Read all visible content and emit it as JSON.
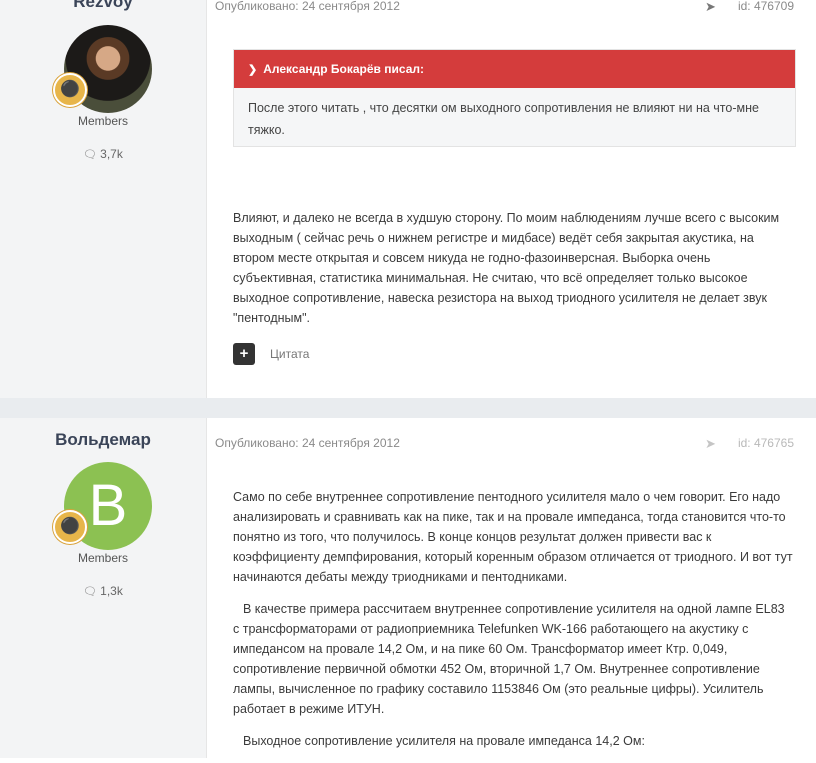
{
  "posts": [
    {
      "author": "Rezvoy",
      "group": "Members",
      "post_count": "3,7k",
      "published": "Опубликовано: 24 сентября 2012",
      "post_id": "id: 476709",
      "quote": {
        "author": "Александр Бокарёв писал:",
        "text": "После этого читать , что десятки ом выходного сопротивления не влияют ни на что-мне тяжко."
      },
      "paragraphs": [
        "Влияют, и далеко не всегда в худшую сторону. По моим наблюдениям лучше всего с высоким выходным ( сейчас речь о нижнем регистре и мидбасе) ведёт себя закрытая акустика, на втором месте открытая и совсем никуда не годно-фазоинверсная. Выборка очень субъективная, статистика минимальная. Не считаю, что всё определяет только высокое выходное сопротивление, навеска резистора на выход триодного усилителя не делает звук \"пентодным\"."
      ],
      "quote_label": "Цитата"
    },
    {
      "author": "Вольдемар",
      "avatar_letter": "B",
      "group": "Members",
      "post_count": "1,3k",
      "published": "Опубликовано: 24 сентября 2012",
      "post_id": "id: 476765",
      "paragraphs": [
        "Само по себе внутреннее сопротивление пентодного усилителя мало о чем говорит. Его надо анализировать и сравнивать как на пике, так и на провале импеданса, тогда становится что-то понятно из того, что получилось. В конце концов результат должен привести вас к коэффициенту демпфирования, который коренным образом отличается от триодного. И вот тут начинаются дебаты между триодниками и пентодниками.",
        "В качестве примера рассчитаем внутреннее сопротивление усилителя на одной лампе EL83 с трансформаторами от радиоприемника Telefunken WK-166 работающего на акустику с импедансом на провале 14,2 Ом, и на пике 60 Ом. Трансформатор имеет Ктр. 0,049, сопротивление первичной обмотки 452 Ом, вторичной 1,7 Ом. Внутреннее сопротивление лампы, вычисленное по графику составило 1153846 Ом (это реальные цифры). Усилитель работает в режиме ИТУН.",
        "Выходное сопротивление усилителя на провале импеданса 14,2 Ом:"
      ]
    }
  ],
  "icons": {
    "share": "share-icon",
    "comment": "comment-icon",
    "rank": "lightbulb-icon",
    "quote_toggle": "chevron-down-icon",
    "add": "plus-icon"
  },
  "colors": {
    "quote_header": "#d43c3c",
    "avatar_bg": "#8cc152",
    "rank_badge": "#e7b54a",
    "author_panel": "#f3f4f5"
  }
}
